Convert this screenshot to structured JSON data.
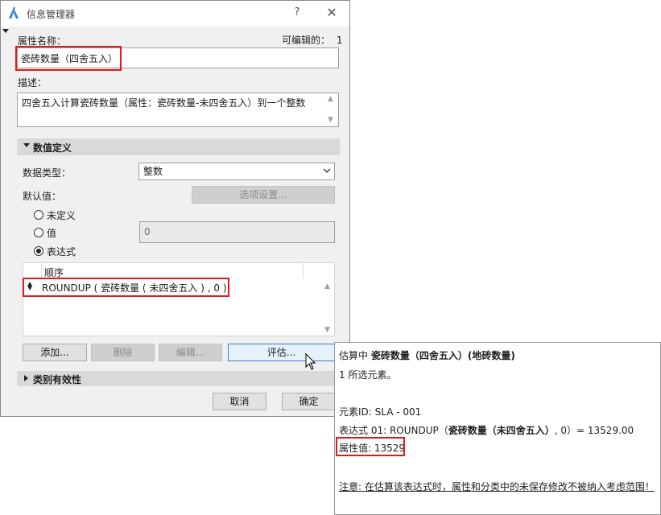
{
  "window": {
    "title": "信息管理器",
    "help": "?",
    "close": "✕"
  },
  "property": {
    "name_label": "属性名称：",
    "editable_label": "可编辑的：",
    "editable_count": "1",
    "name_value": "瓷砖数量（四舍五入）"
  },
  "description": {
    "label": "描述：",
    "text": "四舍五入计算瓷砖数量（属性：瓷砖数量-未四舍五入）到一个整数"
  },
  "value_def": {
    "section_title": "数值定义",
    "data_type_label": "数据类型：",
    "data_type_value": "整数",
    "default_label": "默认值：",
    "options_button": "选项设置...",
    "radio_undefined": "未定义",
    "radio_value": "值",
    "value_input": "0",
    "radio_expression": "表达式",
    "table_header": "顺序",
    "expression_row": "ROUNDUP ( 瓷砖数量 ( 未四舍五入 ) , 0 )"
  },
  "buttons": {
    "add": "添加...",
    "delete": "删除",
    "edit": "编辑...",
    "evaluate": "评估..."
  },
  "category": {
    "section_title": "类别有效性"
  },
  "footer": {
    "cancel": "取消",
    "ok": "确定"
  },
  "eval": {
    "line1_prefix": "估算中",
    "line1_name": "瓷砖数量（四舍五入）(地砖数量)",
    "line2": "1 所选元素。",
    "line3": "元素ID: SLA - 001",
    "line4_prefix": "表达式 01: ROUNDUP（",
    "line4_bold": "瓷砖数量（未四舍五入）",
    "line4_suffix": ", 0）= 13529.00",
    "line5": "属性值: 13529",
    "note": "注意: 在估算该表达式时，属性和分类中的未保存修改不被纳入考虑范围！"
  },
  "colors": {
    "highlight": "#e01a1a",
    "section_bg": "#d9d9d9",
    "focus_border": "#3c7fd6"
  }
}
